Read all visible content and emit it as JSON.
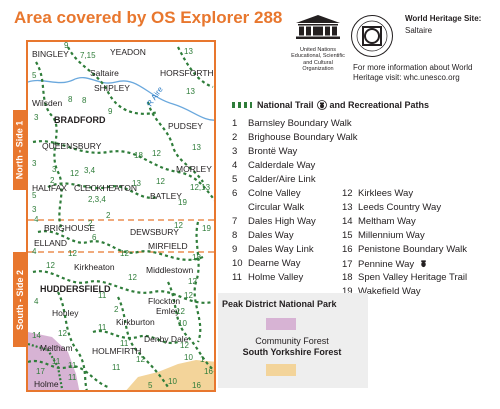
{
  "title": "Area covered by OS Explorer 288",
  "side_tabs": [
    "North - Side 1",
    "South - Side 2"
  ],
  "unesco": {
    "org_name": "United Nations Educational, Scientific and Cultural Organization",
    "logo_text": "UNESCO"
  },
  "whs": {
    "title": "World Heritage Site:",
    "name": "Saltaire",
    "info": "For more information about World Heritage visit: whc.unesco.org"
  },
  "legend": {
    "heading": "National Trail",
    "heading_rest": "and Recreational Paths",
    "routes": [
      {
        "n": "1",
        "name": "Barnsley Boundary Walk"
      },
      {
        "n": "2",
        "name": "Brighouse Boundary Walk"
      },
      {
        "n": "3",
        "name": "Brontë Way"
      },
      {
        "n": "4",
        "name": "Calderdale Way"
      },
      {
        "n": "5",
        "name": "Calder/Aire Link"
      },
      {
        "n": "6",
        "name": "Colne Valley"
      },
      {
        "n": "",
        "name": "Circular Walk"
      },
      {
        "n": "7",
        "name": "Dales High Way"
      },
      {
        "n": "8",
        "name": "Dales Way"
      },
      {
        "n": "9",
        "name": "Dales Way Link"
      },
      {
        "n": "10",
        "name": "Dearne Way"
      },
      {
        "n": "11",
        "name": "Holme Valley"
      },
      {
        "n": "12",
        "name": "Kirklees Way"
      },
      {
        "n": "13",
        "name": "Leeds Country Way"
      },
      {
        "n": "14",
        "name": "Meltham Way"
      },
      {
        "n": "15",
        "name": "Millennium Way"
      },
      {
        "n": "16",
        "name": "Penistone Boundary Walk"
      },
      {
        "n": "17",
        "name": "Pennine Way"
      },
      {
        "n": "18",
        "name": "Spen Valley Heritage Trail"
      },
      {
        "n": "19",
        "name": "Wakefield Way"
      }
    ]
  },
  "key": {
    "peak_district": "Peak District National Park",
    "community_forest": "Community Forest",
    "south_yorkshire_forest": "South Yorkshire Forest",
    "colors": {
      "peak_district": "#d7b3d4",
      "south_yorkshire_forest": "#f3d49a"
    }
  },
  "map": {
    "places": [
      {
        "name": "BINGLEY",
        "big": false
      },
      {
        "name": "YEADON",
        "big": false
      },
      {
        "name": "Saltaire",
        "big": false
      },
      {
        "name": "SHIPLEY",
        "big": false
      },
      {
        "name": "HORSFORTH",
        "big": false
      },
      {
        "name": "Wilsden",
        "big": false
      },
      {
        "name": "BRADFORD",
        "big": true
      },
      {
        "name": "PUDSEY",
        "big": false
      },
      {
        "name": "QUEENSBURY",
        "big": false
      },
      {
        "name": "MORLEY",
        "big": false
      },
      {
        "name": "HALIFAX",
        "big": false
      },
      {
        "name": "CLECKHEATON",
        "big": false
      },
      {
        "name": "BATLEY",
        "big": false
      },
      {
        "name": "BRIGHOUSE",
        "big": false
      },
      {
        "name": "DEWSBURY",
        "big": false
      },
      {
        "name": "ELLAND",
        "big": false
      },
      {
        "name": "MIRFIELD",
        "big": false
      },
      {
        "name": "Kirkheaton",
        "big": false
      },
      {
        "name": "Middlestown",
        "big": false
      },
      {
        "name": "HUDDERSFIELD",
        "big": true
      },
      {
        "name": "Flockton",
        "big": false
      },
      {
        "name": "Emley",
        "big": false
      },
      {
        "name": "Honley",
        "big": false
      },
      {
        "name": "Kirkburton",
        "big": false
      },
      {
        "name": "Denby Dale",
        "big": false
      },
      {
        "name": "Meltham",
        "big": false
      },
      {
        "name": "HOLMFIRTH",
        "big": false
      },
      {
        "name": "Holme",
        "big": false
      }
    ],
    "river": "R Aire",
    "route_numbers": [
      "9",
      "7,15",
      "13",
      "5",
      "13",
      "8",
      "9",
      "3",
      "3",
      "12",
      "13",
      "3",
      "12",
      "12",
      "2",
      "3,4",
      "18",
      "13",
      "12,13",
      "19",
      "5",
      "3",
      "4",
      "2",
      "2",
      "6",
      "4",
      "12",
      "19",
      "12",
      "12",
      "18",
      "12",
      "12",
      "12",
      "4",
      "11",
      "12",
      "12",
      "11",
      "2",
      "12",
      "10",
      "14",
      "11",
      "12",
      "12",
      "10",
      "1",
      "16",
      "11",
      "11",
      "17",
      "11",
      "5",
      "11",
      "10",
      "16",
      "8",
      "2,3,4"
    ]
  }
}
